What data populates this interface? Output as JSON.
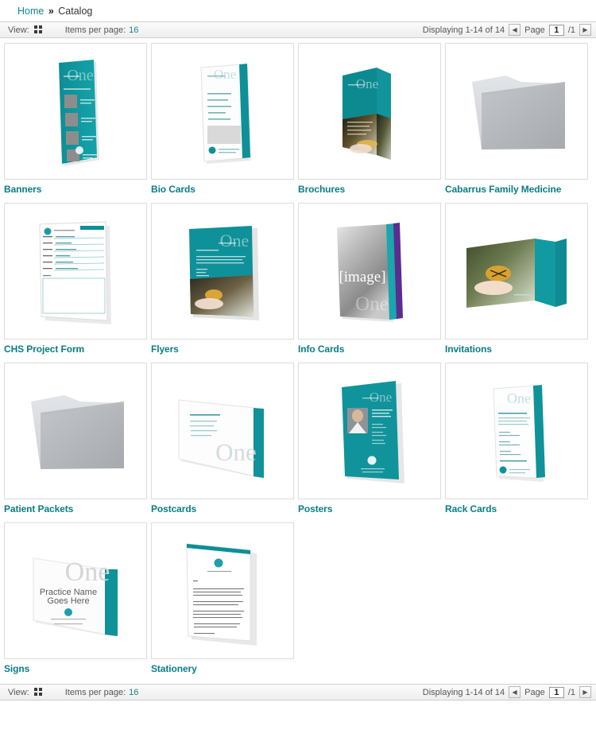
{
  "breadcrumb": {
    "home": "Home",
    "separator": "»",
    "current": "Catalog"
  },
  "toolbar": {
    "view_label": "View:",
    "view_icon": "grid-view-icon",
    "items_per_page_label": "Items per page:",
    "items_per_page_value": "16",
    "displaying": "Displaying 1-14 of 14",
    "prev_arrow": "◀",
    "next_arrow": "▶",
    "page_label": "Page",
    "page_value": "1",
    "page_total": "/1"
  },
  "colors": {
    "teal": "#119099",
    "teal_dark": "#0b7d85",
    "link": "#0b7d85",
    "folder_gray": "#a9abae",
    "folder_light": "#d8dadd",
    "purple": "#5b2d8e"
  },
  "items": [
    {
      "label": "Banners",
      "art": "banner"
    },
    {
      "label": "Bio Cards",
      "art": "bio-card"
    },
    {
      "label": "Brochures",
      "art": "brochure"
    },
    {
      "label": "Cabarrus Family Medicine",
      "art": "folder"
    },
    {
      "label": "CHS Project Form",
      "art": "form"
    },
    {
      "label": "Flyers",
      "art": "flyer"
    },
    {
      "label": "Info Cards",
      "art": "info-card",
      "placeholder_text": "[image]"
    },
    {
      "label": "Invitations",
      "art": "invitation"
    },
    {
      "label": "Patient Packets",
      "art": "folder"
    },
    {
      "label": "Postcards",
      "art": "postcard"
    },
    {
      "label": "Posters",
      "art": "poster"
    },
    {
      "label": "Rack Cards",
      "art": "rack-card"
    },
    {
      "label": "Signs",
      "art": "sign",
      "sign_line1": "Practice Name",
      "sign_line2": "Goes Here"
    },
    {
      "label": "Stationery",
      "art": "stationery"
    }
  ],
  "watermark": {
    "text": "One"
  }
}
